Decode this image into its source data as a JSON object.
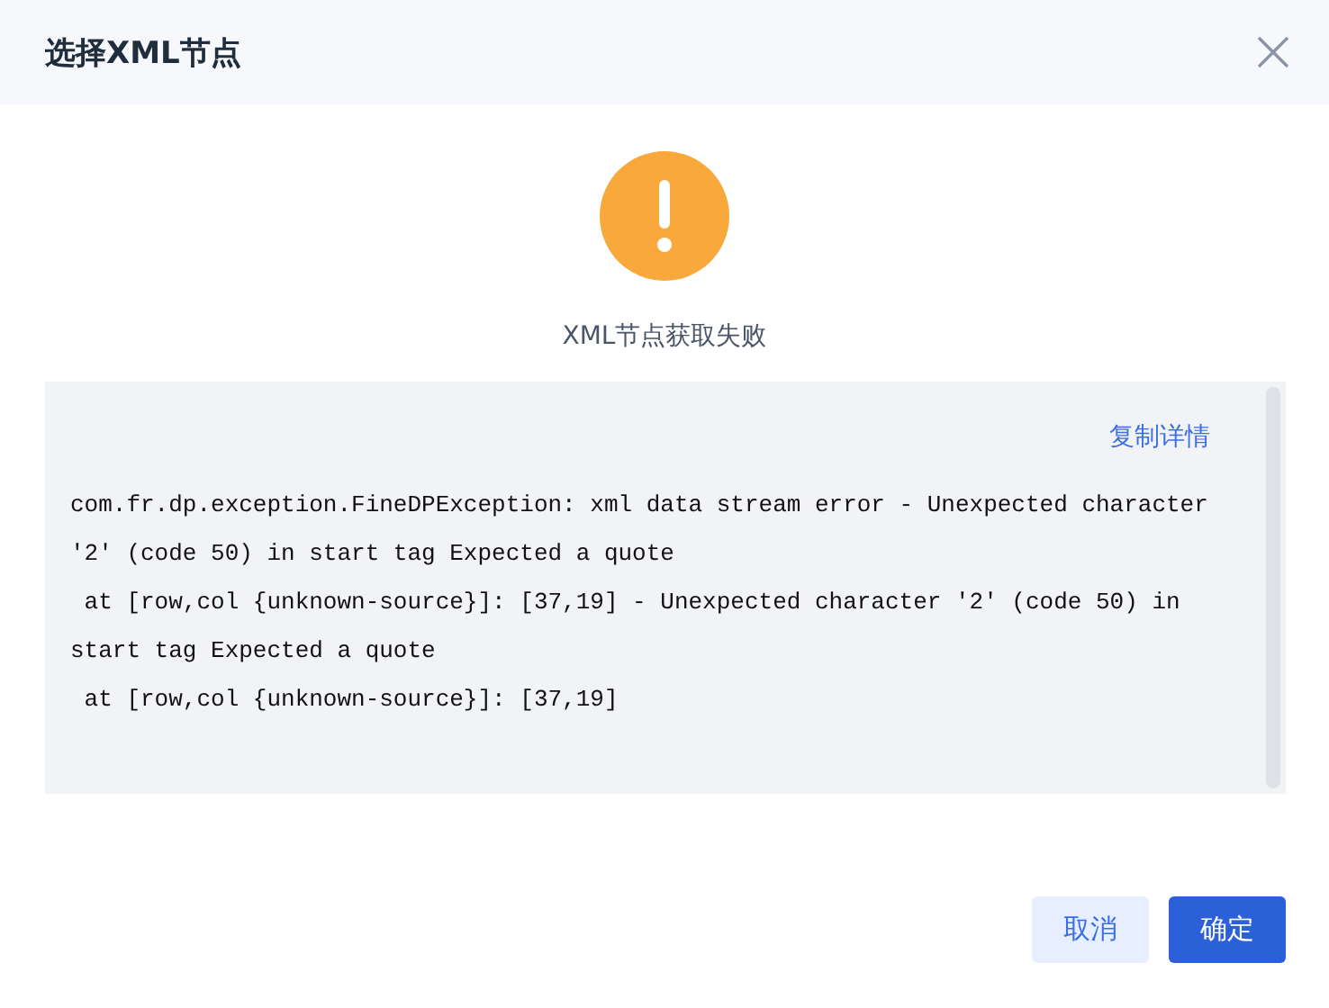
{
  "dialog": {
    "title": "选择XML节点"
  },
  "status": {
    "kind": "warning",
    "message": "XML节点获取失败"
  },
  "details": {
    "copy_link": "复制详情",
    "lines": [
      "com.fr.dp.exception.FineDPException: xml data stream error - Unexpected character",
      "'2' (code 50) in start tag Expected a quote",
      " at [row,col {unknown-source}]: [37,19] - Unexpected character '2' (code 50) in",
      "start tag Expected a quote",
      " at [row,col {unknown-source}]: [37,19]"
    ]
  },
  "buttons": [
    {
      "label": "取消",
      "kind": "secondary"
    },
    {
      "label": "确定",
      "kind": "primary"
    }
  ]
}
